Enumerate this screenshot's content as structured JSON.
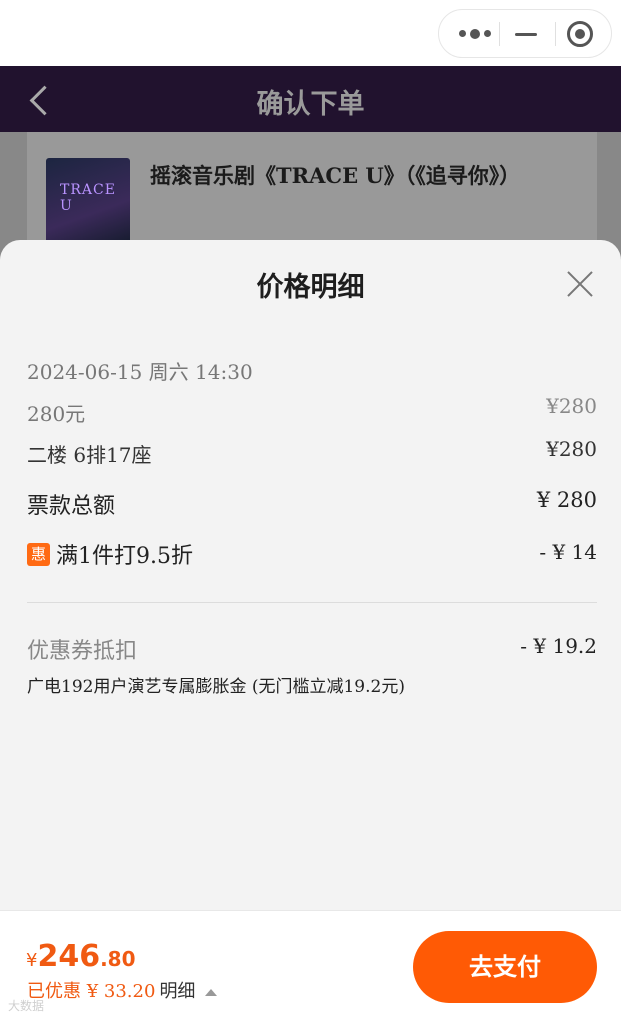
{
  "navbar": {
    "title": "确认下单"
  },
  "show": {
    "title": "摇滚音乐剧《TRACE U》（《追寻你》）",
    "poster_text": "TRACE U"
  },
  "sheet": {
    "title": "价格明细",
    "session": "2024-06-15 周六 14:30",
    "tier_label": "280元",
    "tier_price": "¥280",
    "seat_label": "二楼 6排17座",
    "seat_price": "¥280",
    "total_label": "票款总额",
    "total_value": "¥ 280",
    "discount_icon": "惠",
    "discount_label": "满1件打9.5折",
    "discount_value": "- ¥ 14",
    "coupon_label": "优惠券抵扣",
    "coupon_value": "- ¥ 19.2",
    "coupon_desc": "广电192用户演艺专属膨胀金 (无门槛立减19.2元)"
  },
  "bottom": {
    "currency": "¥",
    "price_int": "246",
    "price_dec": ".80",
    "saved_label": "已优惠 ¥ 33.20",
    "detail_label": "明细",
    "pay_label": "去支付",
    "watermark": "大数据"
  },
  "colors": {
    "accent": "#ff5a05",
    "nav_bg": "#21122e"
  }
}
